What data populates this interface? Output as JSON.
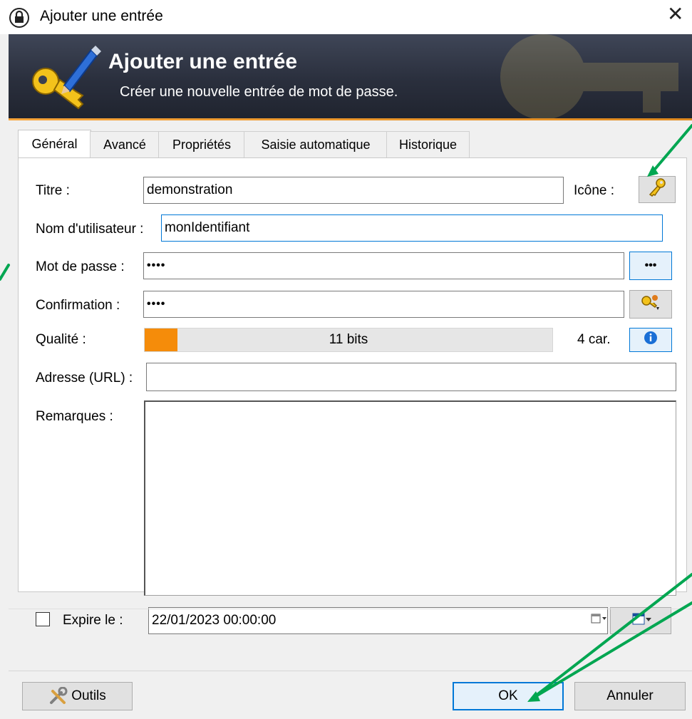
{
  "window": {
    "title": "Ajouter une entrée",
    "close_glyph": "✕"
  },
  "banner": {
    "title": "Ajouter une entrée",
    "subtitle": "Créer une nouvelle entrée de mot de passe."
  },
  "tabs": [
    {
      "label": "Général",
      "active": true
    },
    {
      "label": "Avancé"
    },
    {
      "label": "Propriétés"
    },
    {
      "label": "Saisie automatique"
    },
    {
      "label": "Historique"
    }
  ],
  "form": {
    "title_label": "Titre :",
    "title_value": "demonstration",
    "icon_label": "Icône :",
    "icon_name": "key-icon",
    "username_label": "Nom d'utilisateur :",
    "username_value": "monIdentifiant",
    "password_label": "Mot de passe :",
    "password_value": "••••",
    "password_toggle": "•••",
    "confirm_label": "Confirmation :",
    "confirm_value": "••••",
    "quality_label": "Qualité :",
    "quality_fraction": 0.08,
    "quality_text": "11 bits",
    "char_count": "4 car.",
    "url_label": "Adresse (URL) :",
    "url_value": "",
    "notes_label": "Remarques :",
    "notes_value": "",
    "expire_label": "Expire le :",
    "expire_checked": false,
    "expire_value": "22/01/2023 00:00:00"
  },
  "footer": {
    "tools_label": "Outils",
    "ok_label": "OK",
    "cancel_label": "Annuler"
  },
  "colors": {
    "accent": "#0078d7",
    "quality": "#f58c0a",
    "annotation_arrow": "#00a651",
    "banner_bg": "#2a2f3d"
  }
}
